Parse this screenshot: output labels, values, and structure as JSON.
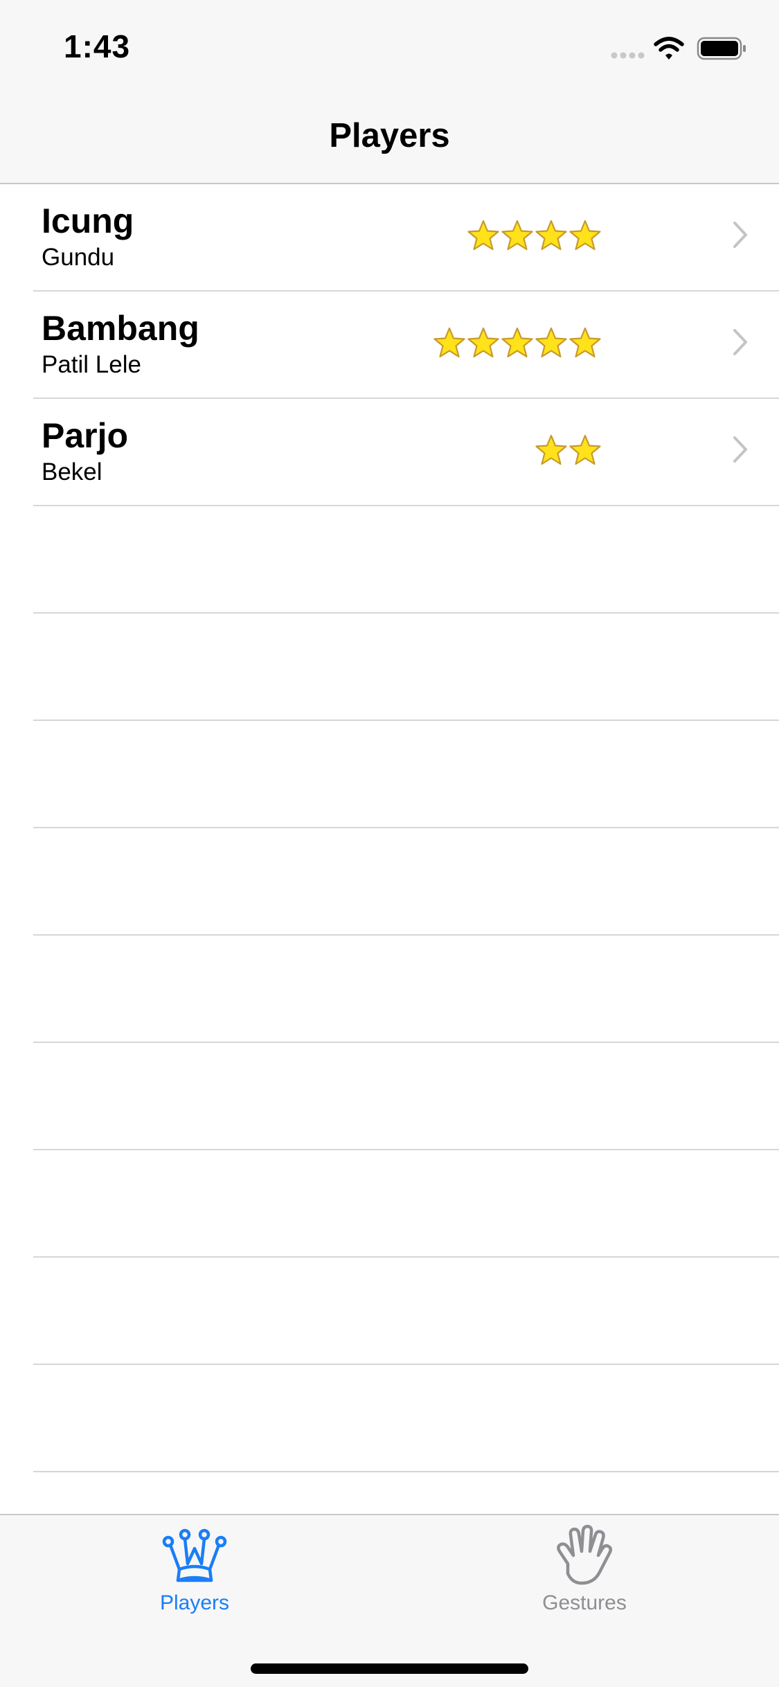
{
  "status_bar": {
    "time": "1:43",
    "icons": [
      "signal-dots-icon",
      "wifi-icon",
      "battery-icon"
    ]
  },
  "nav": {
    "title": "Players"
  },
  "players": [
    {
      "name": "Icung",
      "game": "Gundu",
      "rating": 4
    },
    {
      "name": "Bambang",
      "game": "Patil Lele",
      "rating": 5
    },
    {
      "name": "Parjo",
      "game": "Bekel",
      "rating": 2
    }
  ],
  "empty_rows": 9,
  "tab_bar": {
    "tabs": [
      {
        "label": "Players",
        "icon": "crown-icon",
        "selected": true
      },
      {
        "label": "Gestures",
        "icon": "hand-icon",
        "selected": false
      }
    ]
  },
  "colors": {
    "accent": "#1a7ef6",
    "inactive": "#8e8e93",
    "star_fill": "#ffe21a",
    "star_stroke": "#c79a2a",
    "bar_background": "#f7f7f7",
    "separator": "#d6d6d9",
    "chevron": "#c4c4c7"
  }
}
